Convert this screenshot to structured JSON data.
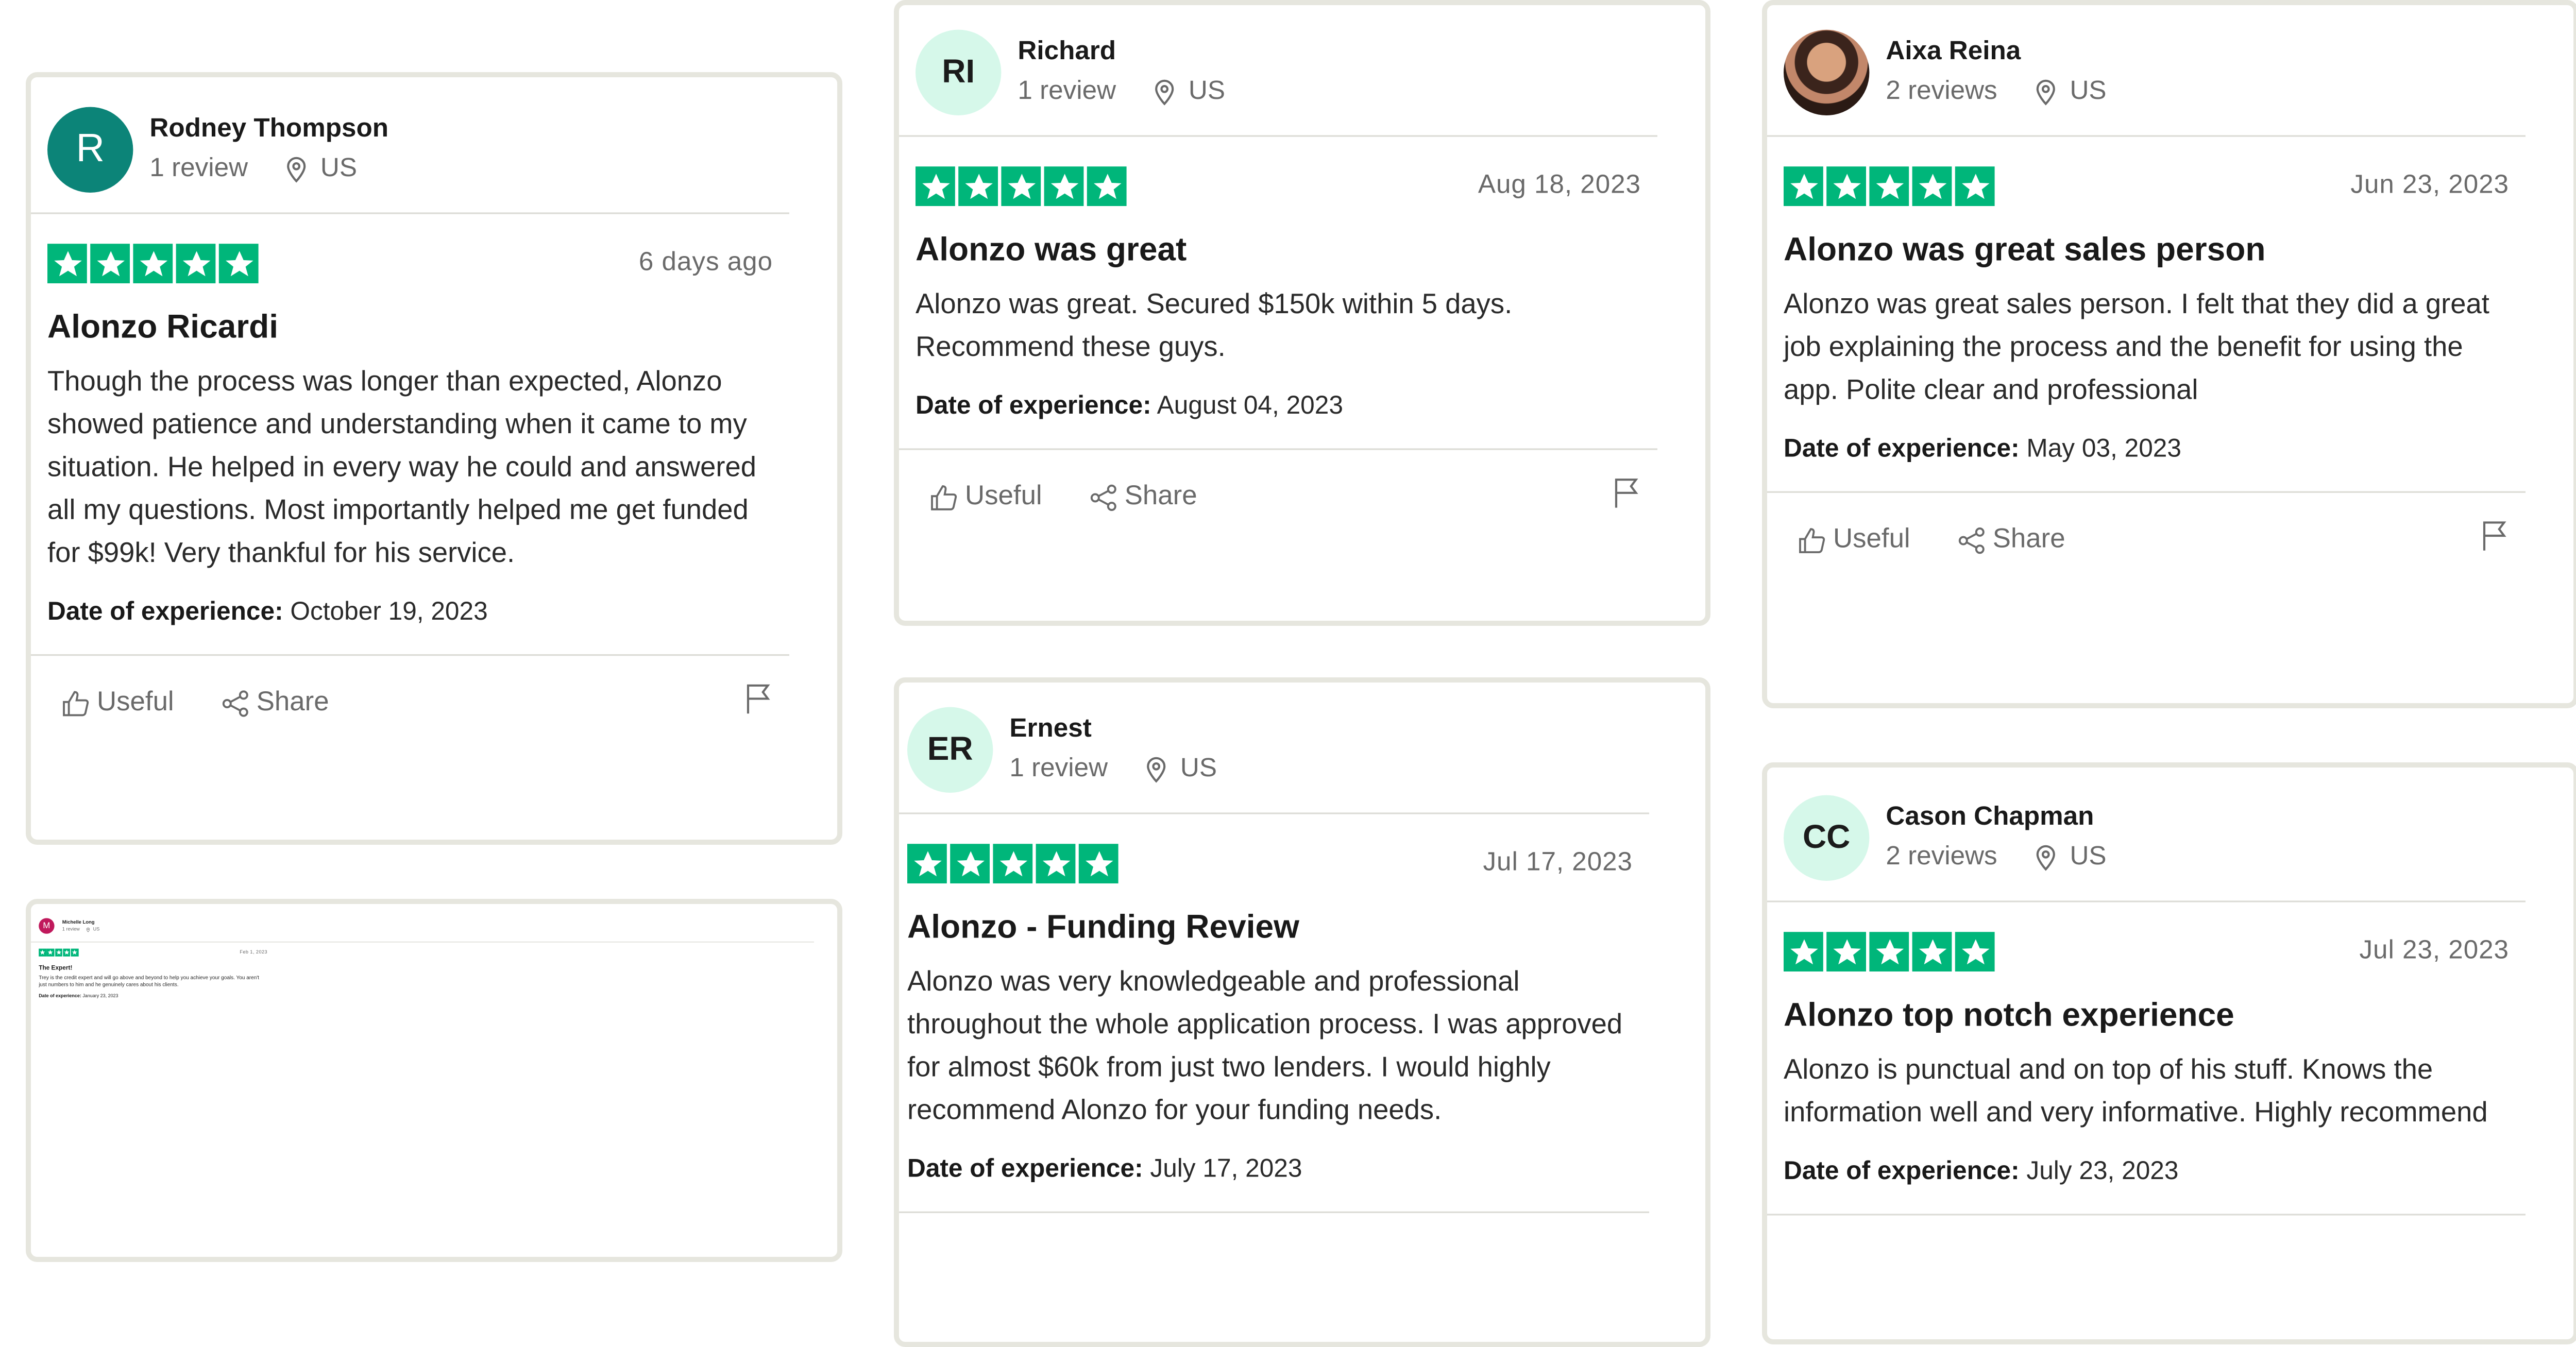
{
  "reviews": [
    {
      "name": "Rodney Thompson",
      "initials": "R",
      "count": "1 review",
      "country": "US",
      "date": "6 days ago",
      "title": "Alonzo Ricardi",
      "body": "Though the process was longer than expected, Alonzo showed patience and understanding when it came to my situation. He helped in every way he could and answered all my questions. Most importantly helped me get funded for $99k! Very thankful for his service.",
      "exp_label": "Date of experience:",
      "exp_date": "October 19, 2023",
      "useful": "Useful",
      "share": "Share"
    },
    {
      "name": "Michelle Long",
      "initials": "M",
      "count": "1 review",
      "country": "US",
      "date": "Feb 1, 2023",
      "title": "The Expert!",
      "body": "Trey is the credit expert and will go above and beyond to help you achieve your goals. You aren't just numbers to him and he genuinely cares about his clients.",
      "exp_label": "Date of experience:",
      "exp_date": "January 23, 2023"
    },
    {
      "name": "Richard",
      "initials": "RI",
      "count": "1 review",
      "country": "US",
      "date": "Aug 18, 2023",
      "title": "Alonzo was great",
      "body": "Alonzo was great. Secured $150k within 5 days. Recommend these guys.",
      "exp_label": "Date of experience:",
      "exp_date": "August 04, 2023",
      "useful": "Useful",
      "share": "Share"
    },
    {
      "name": "Ernest",
      "initials": "ER",
      "count": "1 review",
      "country": "US",
      "date": "Jul 17, 2023",
      "title": "Alonzo - Funding Review",
      "body": "Alonzo was very knowledgeable and professional throughout the whole application process. I was approved for almost $60k from just two lenders. I would highly recommend Alonzo for your funding needs.",
      "exp_label": "Date of experience:",
      "exp_date": "July 17, 2023"
    },
    {
      "name": "Aixa Reina",
      "initials": "",
      "count": "2 reviews",
      "country": "US",
      "date": "Jun 23, 2023",
      "title": "Alonzo was great sales person",
      "body": "Alonzo was great sales person. I felt that they did a great job explaining the process and the benefit for using the app. Polite clear and professional",
      "exp_label": "Date of experience:",
      "exp_date": "May 03, 2023",
      "useful": "Useful",
      "share": "Share"
    },
    {
      "name": "Cason Chapman",
      "initials": "CC",
      "count": "2 reviews",
      "country": "US",
      "date": "Jul 23, 2023",
      "title": "Alonzo top notch experience",
      "body": "Alonzo is punctual and on top of his stuff. Knows the information well and very informative. Highly recommend",
      "exp_label": "Date of experience:",
      "exp_date": "July 23, 2023"
    }
  ],
  "colors": {
    "star_green": "#00b67a",
    "card_border": "#e6e6de",
    "teal_avatar": "#0c8478",
    "mint_avatar": "#d6f8ea",
    "pink_avatar": "#c0195c"
  },
  "icons": [
    "location-pin-icon",
    "star-icon",
    "thumbs-up-icon",
    "share-icon",
    "flag-icon"
  ]
}
